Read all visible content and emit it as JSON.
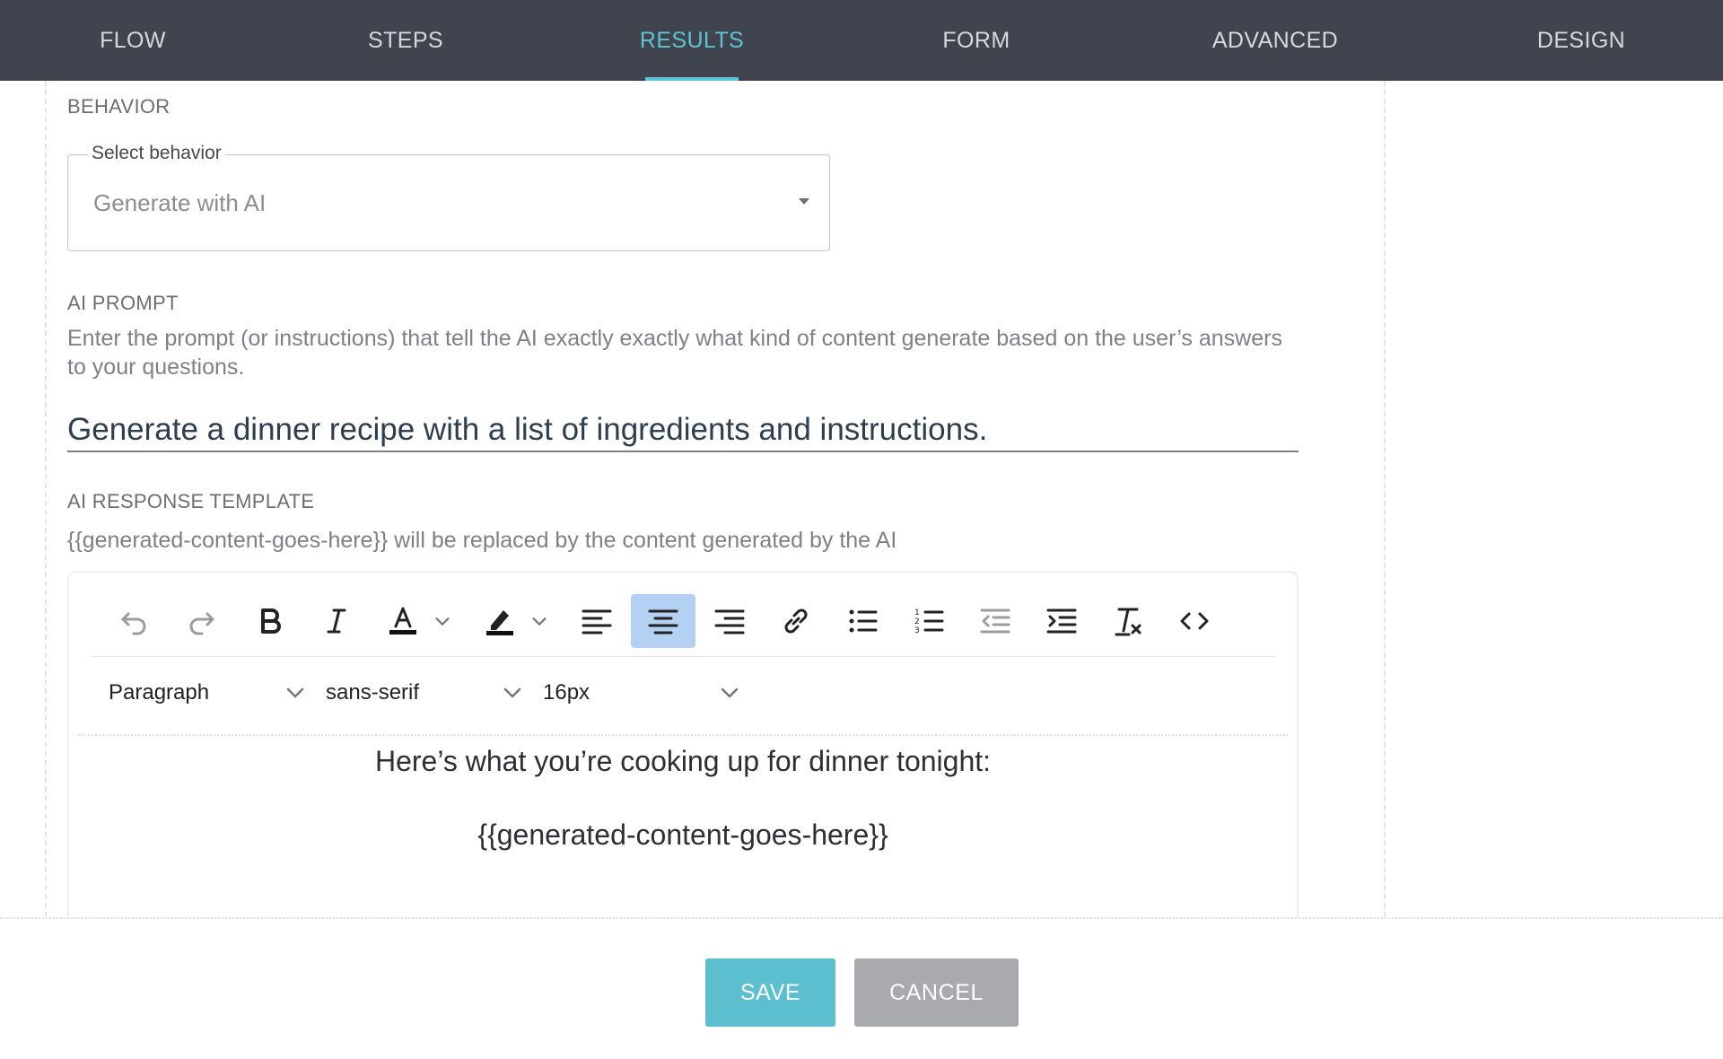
{
  "nav": {
    "tabs": [
      {
        "label": "FLOW"
      },
      {
        "label": "STEPS"
      },
      {
        "label": "RESULTS",
        "active": true
      },
      {
        "label": "FORM"
      },
      {
        "label": "ADVANCED"
      },
      {
        "label": "DESIGN"
      }
    ],
    "active_color": "#5ec4d4",
    "background": "#40444f"
  },
  "behavior": {
    "section_label": "BEHAVIOR",
    "select_label": "Select behavior",
    "selected_value": "Generate with AI"
  },
  "ai_prompt": {
    "section_label": "AI PROMPT",
    "help_text": "Enter the prompt (or instructions) that tell the AI exactly exactly what kind of content generate based on the user’s answers to your questions.",
    "value": "Generate a dinner recipe with a list of ingredients and instructions."
  },
  "ai_response_template": {
    "section_label": "AI RESPONSE TEMPLATE",
    "help_text": "{{generated-content-goes-here}} will be replaced by the content generated by the AI",
    "toolbar": {
      "buttons": [
        "undo-icon",
        "redo-icon",
        "bold-icon",
        "italic-icon",
        "text-color-icon",
        "highlight-icon",
        "align-left-icon",
        "align-center-icon",
        "align-right-icon",
        "link-icon",
        "bullet-list-icon",
        "numbered-list-icon",
        "outdent-icon",
        "indent-icon",
        "clear-format-icon",
        "code-icon"
      ],
      "active_button": "align-center-icon",
      "block_format": "Paragraph",
      "font_family": "sans-serif",
      "font_size": "16px"
    },
    "content": {
      "line1": "Here’s what you’re cooking up for dinner tonight:",
      "line2": "{{generated-content-goes-here}}"
    }
  },
  "footer": {
    "save_label": "SAVE",
    "cancel_label": "CANCEL",
    "save_color": "#5bbfcf",
    "cancel_color": "#a9aaae"
  }
}
